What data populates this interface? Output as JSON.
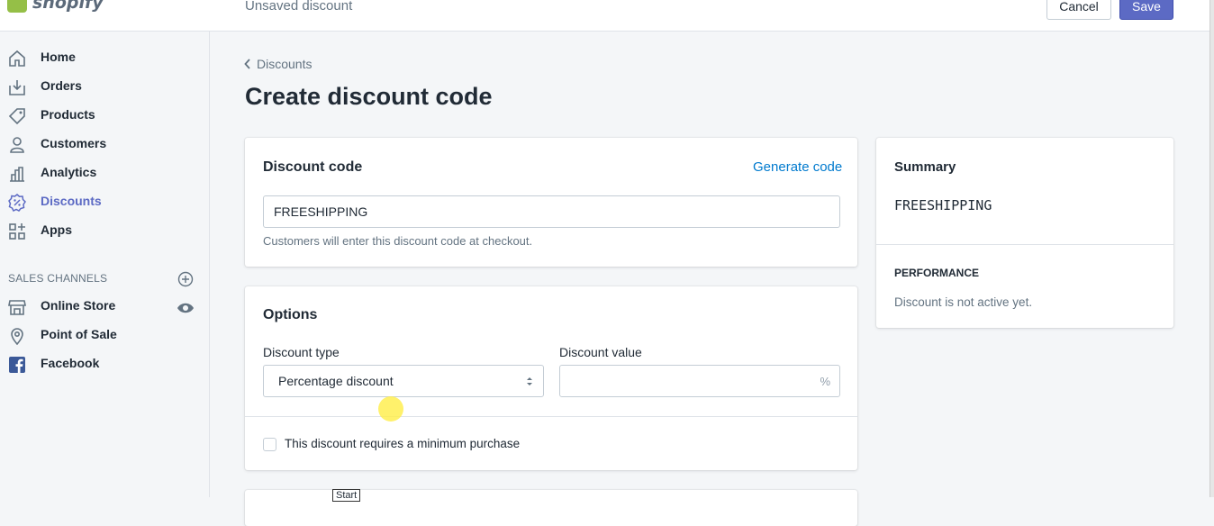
{
  "app": {
    "logo_text": "shopify",
    "header_title": "Unsaved discount"
  },
  "toolbar": {
    "cancel_label": "Cancel",
    "save_label": "Save"
  },
  "sidebar": {
    "items": [
      {
        "label": "Home",
        "icon": "home-icon"
      },
      {
        "label": "Orders",
        "icon": "orders-icon"
      },
      {
        "label": "Products",
        "icon": "tag-icon"
      },
      {
        "label": "Customers",
        "icon": "person-icon"
      },
      {
        "label": "Analytics",
        "icon": "bar-chart-icon"
      },
      {
        "label": "Discounts",
        "icon": "percent-badge-icon",
        "active": true
      },
      {
        "label": "Apps",
        "icon": "apps-grid-icon"
      }
    ],
    "channels_heading": "SALES CHANNELS",
    "channels": [
      {
        "label": "Online Store",
        "icon": "store-icon"
      },
      {
        "label": "Point of Sale",
        "icon": "location-pin-icon"
      },
      {
        "label": "Facebook",
        "icon": "facebook-icon"
      }
    ]
  },
  "main": {
    "breadcrumb": "Discounts",
    "page_title": "Create discount code",
    "discount_card": {
      "title": "Discount code",
      "generate_link": "Generate code",
      "code_value": "FREESHIPPING",
      "help_text": "Customers will enter this discount code at checkout."
    },
    "options_card": {
      "title": "Options",
      "type_label": "Discount type",
      "type_value": "Percentage discount",
      "value_label": "Discount value",
      "value_suffix": "%",
      "min_purchase_label": "This discount requires a minimum purchase"
    },
    "summary": {
      "title": "Summary",
      "code": "FREESHIPPING",
      "performance_heading": "PERFORMANCE",
      "performance_text": "Discount is not active yet."
    }
  },
  "overlay": {
    "tooltip": "Start"
  },
  "colors": {
    "accent": "#5c6ac4",
    "link": "#007ace",
    "brand_green": "#95bf47"
  }
}
